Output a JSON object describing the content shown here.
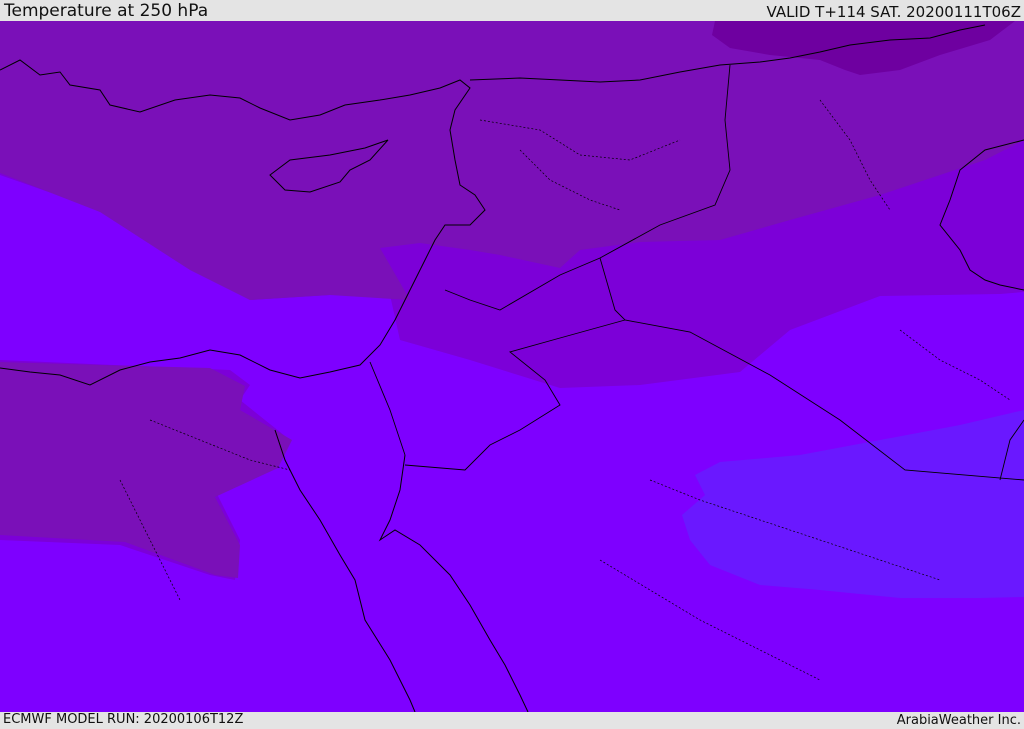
{
  "header": {
    "title": "Temperature at 250 hPa",
    "valid": "VALID T+114 SAT. 20200111T06Z"
  },
  "footer": {
    "model_run": "ECMWF MODEL RUN: 20200106T12Z",
    "credit": "ArabiaWeather Inc."
  },
  "map": {
    "field": "temperature",
    "level": "250 hPa",
    "colors": {
      "coldest": "#6e00a0",
      "cold": "#7a10b8",
      "mid": "#7c00d8",
      "warm": "#7e00ff",
      "warmest": "#6a18ff",
      "coast": "#000000",
      "border": "#000000"
    }
  }
}
